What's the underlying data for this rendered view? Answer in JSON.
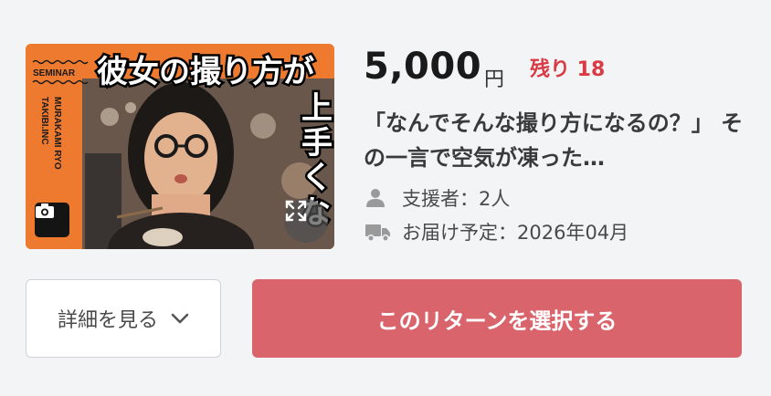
{
  "reward": {
    "thumbnail": {
      "label_seminar": "SEMINAR",
      "side_text_1": "TAKIBI.INC",
      "side_text_2": "MURAKAMI RYO",
      "headline_1": "彼女の撮り方が",
      "headline_2": "上手くな",
      "camera_badge_icon": "camera-icon",
      "expand_icon": "expand-icon",
      "accent_color": "#ee7a2f"
    },
    "price": "5,000",
    "currency": "円",
    "remaining": "残り 18",
    "title": "「なんでそんな撮り方になるの？」 その一言で空気が凍った…",
    "backers_icon": "person-icon",
    "backers": "支援者：2人",
    "delivery_icon": "truck-icon",
    "delivery": "お届け予定：2026年04月"
  },
  "actions": {
    "details_label": "詳細を見る",
    "details_icon": "chevron-down-icon",
    "select_label": "このリターンを選択する",
    "select_color": "#d9646c"
  }
}
